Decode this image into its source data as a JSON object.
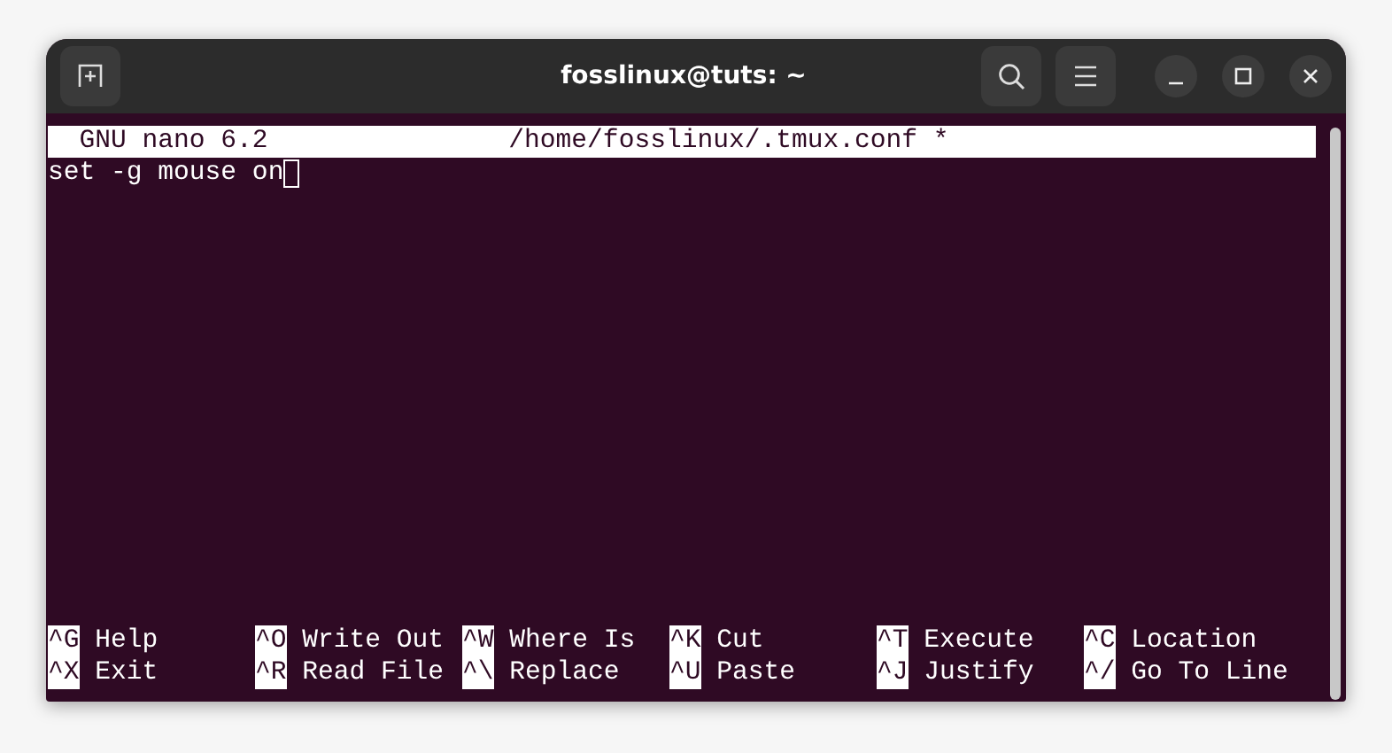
{
  "window": {
    "title": "fosslinux@tuts: ~"
  },
  "editor": {
    "version": "GNU nano 6.2",
    "file_name": "/home/fosslinux/.tmux.conf *",
    "lines": [
      "set -g mouse on"
    ],
    "shortcuts": [
      {
        "key": "^G",
        "label": "Help"
      },
      {
        "key": "^O",
        "label": "Write Out"
      },
      {
        "key": "^W",
        "label": "Where Is"
      },
      {
        "key": "^K",
        "label": "Cut"
      },
      {
        "key": "^T",
        "label": "Execute"
      },
      {
        "key": "^C",
        "label": "Location"
      },
      {
        "key": "^X",
        "label": "Exit"
      },
      {
        "key": "^R",
        "label": "Read File"
      },
      {
        "key": "^\\",
        "label": "Replace"
      },
      {
        "key": "^U",
        "label": "Paste"
      },
      {
        "key": "^J",
        "label": "Justify"
      },
      {
        "key": "^/",
        "label": "Go To Line"
      }
    ]
  }
}
